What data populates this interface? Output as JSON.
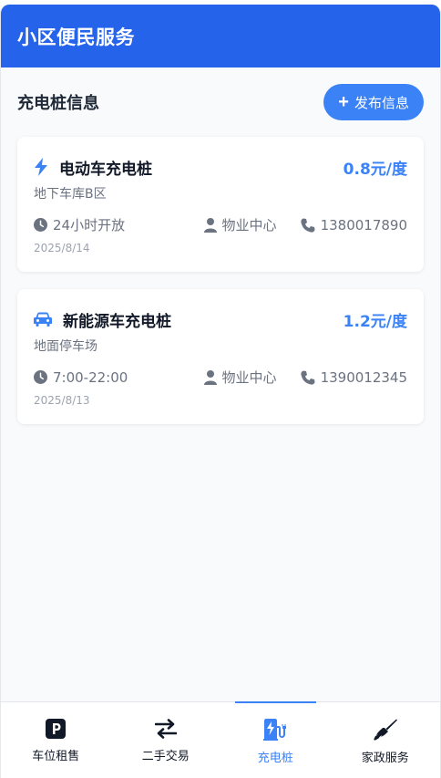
{
  "app": {
    "title": "小区便民服务"
  },
  "section": {
    "title": "充电桩信息",
    "post_button": "发布信息"
  },
  "cards": [
    {
      "icon": "lightning-icon",
      "title": "电动车充电桩",
      "price": "0.8元/度",
      "location": "地下车库B区",
      "hours": "24小时开放",
      "contact": "物业中心",
      "phone": "1380017890",
      "date": "2025/8/14"
    },
    {
      "icon": "car-icon",
      "title": "新能源车充电桩",
      "price": "1.2元/度",
      "location": "地面停车场",
      "hours": "7:00-22:00",
      "contact": "物业中心",
      "phone": "1390012345",
      "date": "2025/8/13"
    }
  ],
  "nav": [
    {
      "label": "车位租售",
      "icon": "parking-icon"
    },
    {
      "label": "二手交易",
      "icon": "exchange-arrows-icon"
    },
    {
      "label": "充电桩",
      "icon": "charging-station-icon",
      "active": true
    },
    {
      "label": "家政服务",
      "icon": "broom-icon"
    }
  ],
  "colors": {
    "header": "#2563eb",
    "accent": "#3b82f6"
  }
}
